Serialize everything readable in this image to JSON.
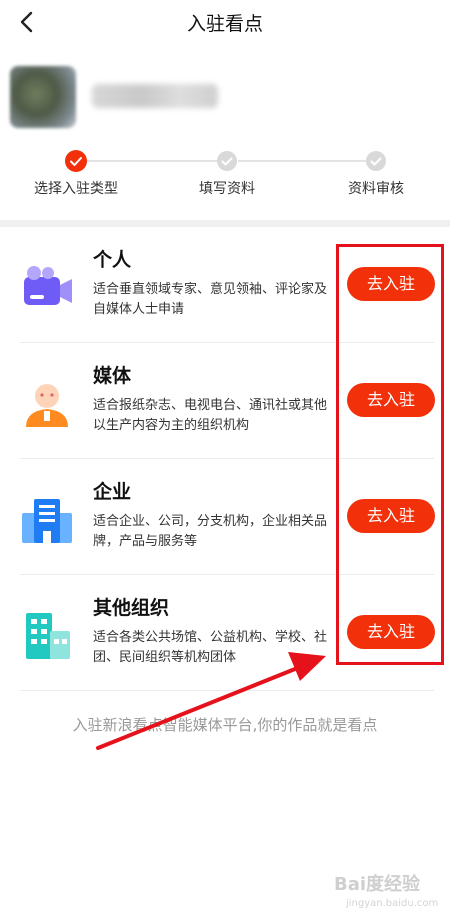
{
  "header": {
    "title": "入驻看点"
  },
  "steps": [
    {
      "label": "选择入驻类型",
      "status": "done"
    },
    {
      "label": "填写资料",
      "status": "pending"
    },
    {
      "label": "资料审核",
      "status": "pending"
    }
  ],
  "colors": {
    "accent": "#f2300a",
    "annotation": "#e5121b"
  },
  "rows": [
    {
      "title": "个人",
      "desc": "适合垂直领域专家、意见领袖、评论家及自媒体人士申请",
      "button": "去入驻",
      "icon": "camera-person-icon"
    },
    {
      "title": "媒体",
      "desc": "适合报纸杂志、电视电台、通讯社或其他以生产内容为主的组织机构",
      "button": "去入驻",
      "icon": "media-person-icon"
    },
    {
      "title": "企业",
      "desc": "适合企业、公司，分支机构，企业相关品牌，产品与服务等",
      "button": "去入驻",
      "icon": "enterprise-building-icon"
    },
    {
      "title": "其他组织",
      "desc": "适合各类公共场馆、公益机构、学校、社团、民间组织等机构团体",
      "button": "去入驻",
      "icon": "organization-building-icon"
    }
  ],
  "footer": {
    "text": "入驻新浪看点智能媒体平台,你的作品就是看点"
  },
  "watermark": {
    "brand": "Bai度经验",
    "url": "jingyan.baidu.com"
  }
}
